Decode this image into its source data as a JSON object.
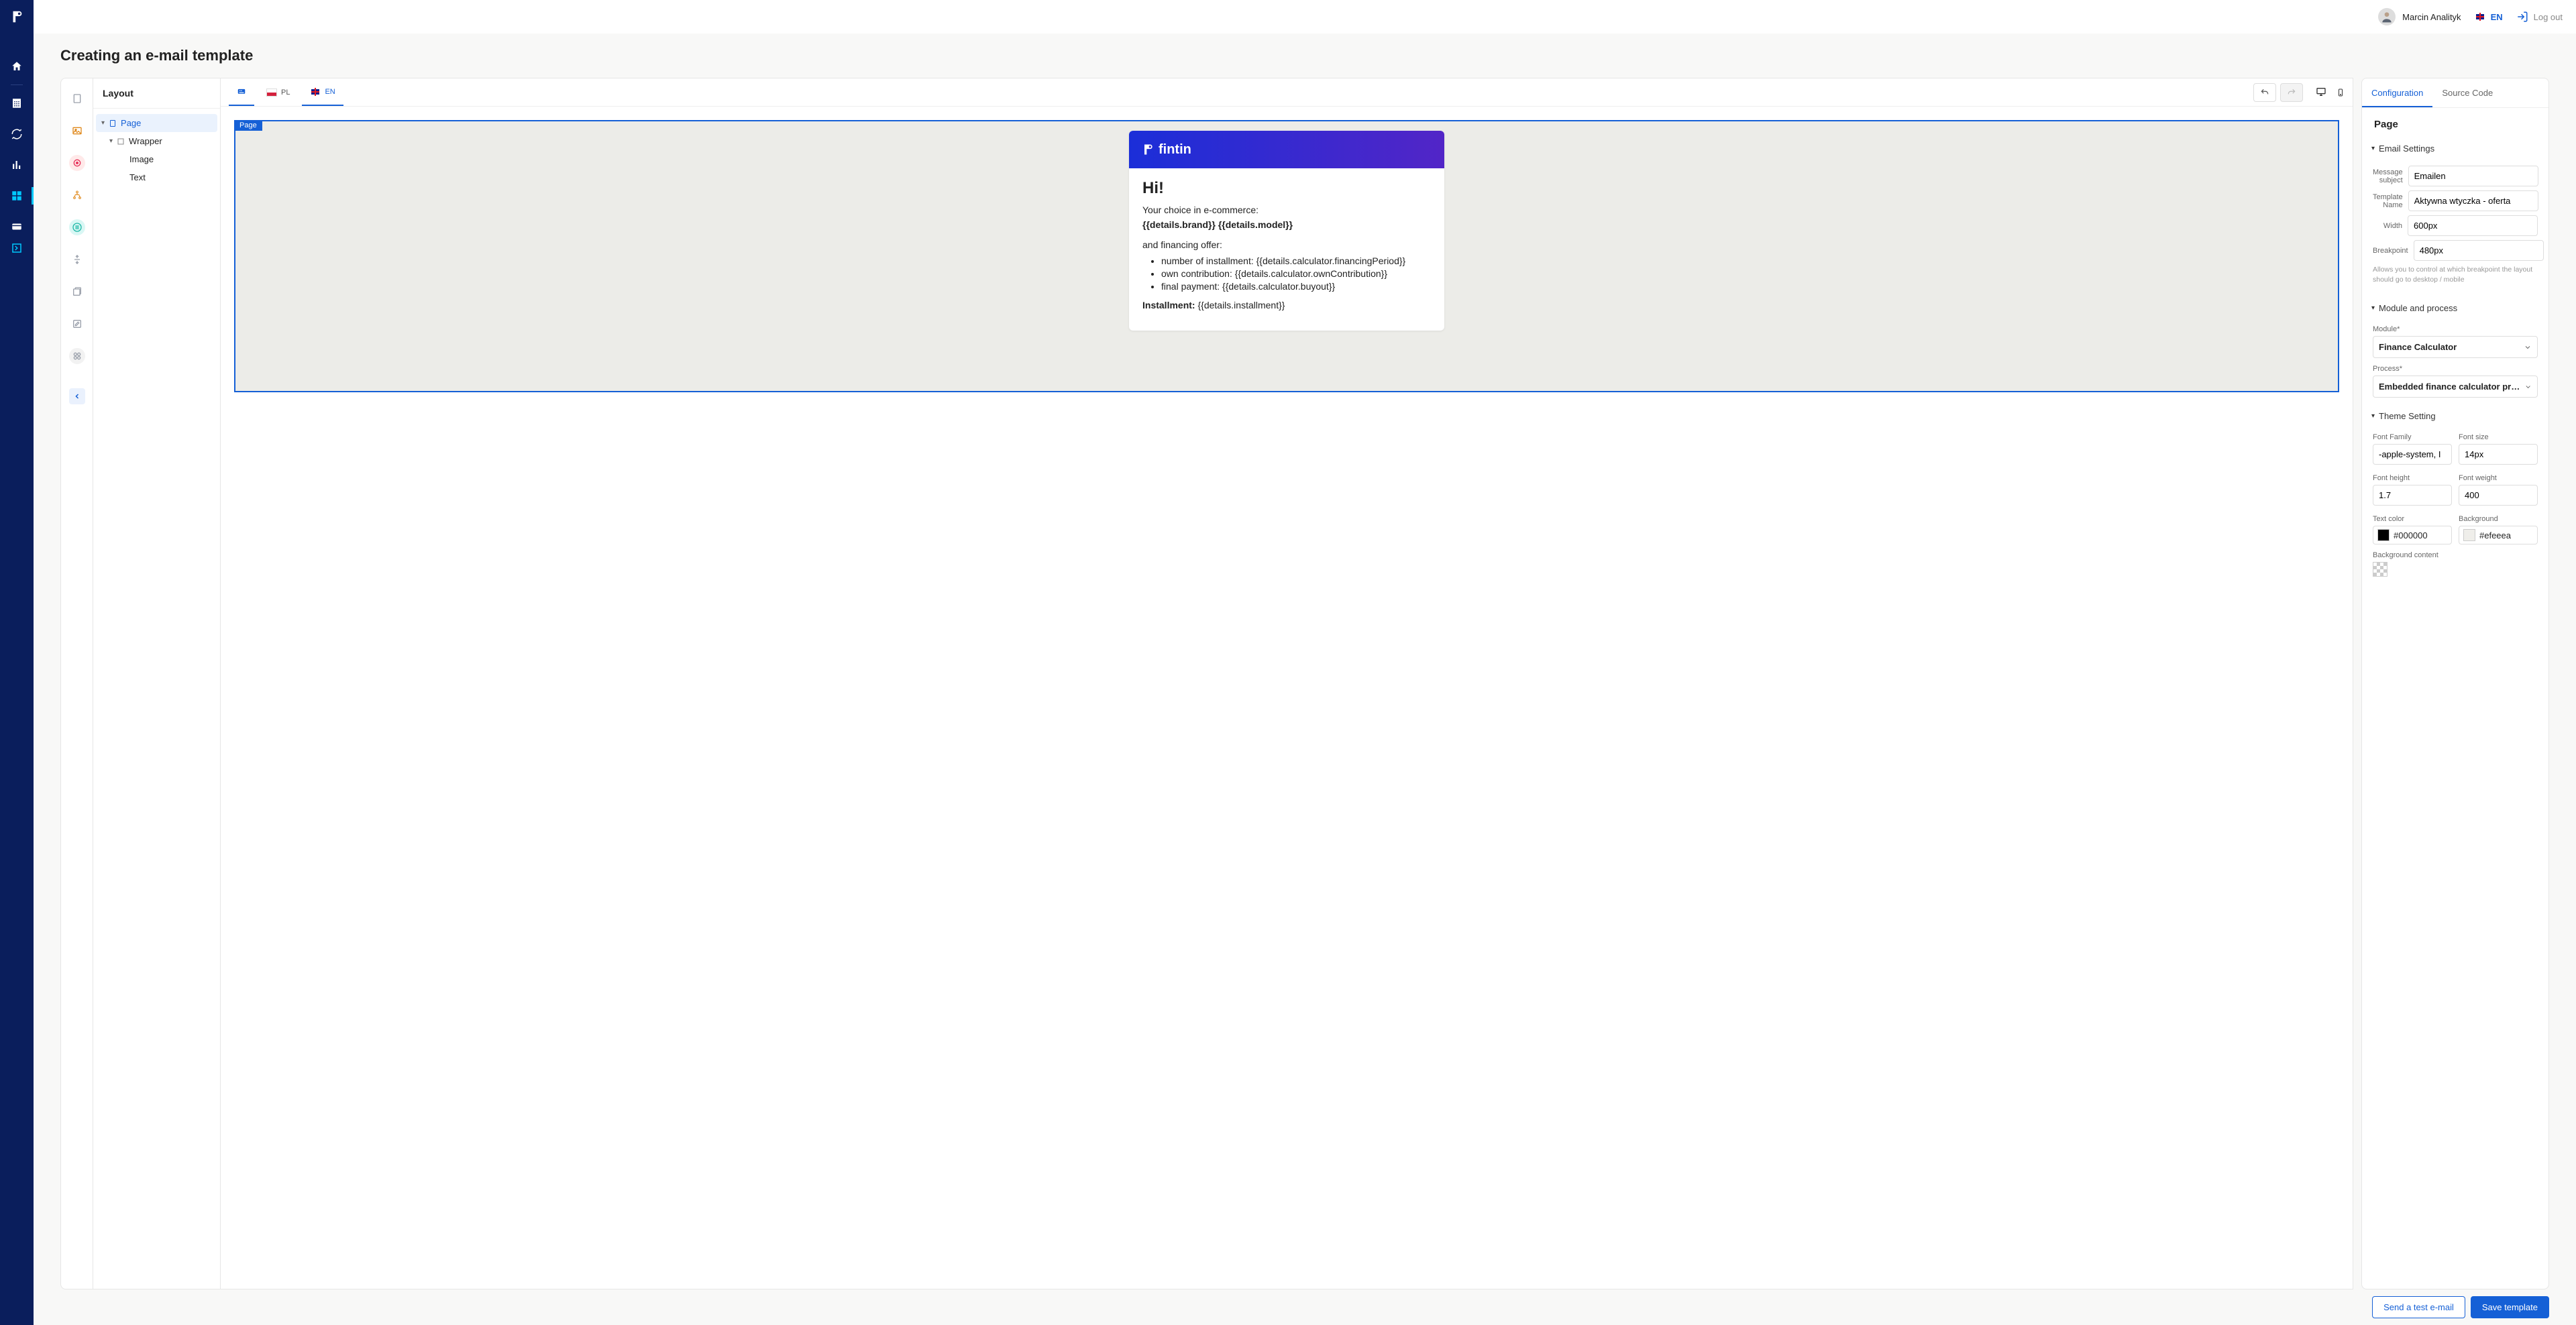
{
  "topbar": {
    "user_name": "Marcin Analityk",
    "lang_label": "EN",
    "logout_label": "Log out"
  },
  "page": {
    "title": "Creating an e-mail template"
  },
  "layout_panel": {
    "title": "Layout",
    "tree": {
      "page": "Page",
      "wrapper": "Wrapper",
      "image": "Image",
      "text": "Text"
    }
  },
  "canvas": {
    "lang_tabs": {
      "pl": "PL",
      "en": "EN"
    },
    "page_tag": "Page",
    "email": {
      "brand": "fintin",
      "greeting": "Hi!",
      "choice_line": "Your choice in e-commerce:",
      "brand_model": "{{details.brand}} {{details.model}}",
      "financing_line": "and financing offer:",
      "bullets": [
        "number of installment: {{details.calculator.financingPeriod}}",
        "own contribution: {{details.calculator.ownContribution}}",
        "final payment: {{details.calculator.buyout}}"
      ],
      "installment_label": "Installment:",
      "installment_value": "{{details.installment}}"
    }
  },
  "config": {
    "tabs": {
      "config": "Configuration",
      "source": "Source Code"
    },
    "page_label": "Page",
    "sections": {
      "email": "Email Settings",
      "module": "Module and process",
      "theme": "Theme Setting"
    },
    "email_settings": {
      "subject_label": "Message subject",
      "subject_value": "Emailen",
      "name_label": "Template Name",
      "name_value": "Aktywna wtyczka - oferta",
      "width_label": "Width",
      "width_value": "600px",
      "breakpoint_label": "Breakpoint",
      "breakpoint_value": "480px",
      "breakpoint_hint": "Allows you to control at which breakpoint the layout should go to desktop / mobile"
    },
    "module": {
      "module_label": "Module*",
      "module_value": "Finance Calculator",
      "process_label": "Process*",
      "process_value": "Embedded finance calculator proce..."
    },
    "theme": {
      "font_family_label": "Font Family",
      "font_family_value": "-apple-system, I",
      "font_size_label": "Font size",
      "font_size_value": "14px",
      "font_height_label": "Font height",
      "font_height_value": "1.7",
      "font_weight_label": "Font weight",
      "font_weight_value": "400",
      "text_color_label": "Text color",
      "text_color_value": "#000000",
      "background_label": "Background",
      "background_value": "#efeeea",
      "bg_content_label": "Background content"
    }
  },
  "footer": {
    "send_test": "Send a test e-mail",
    "save": "Save template"
  }
}
